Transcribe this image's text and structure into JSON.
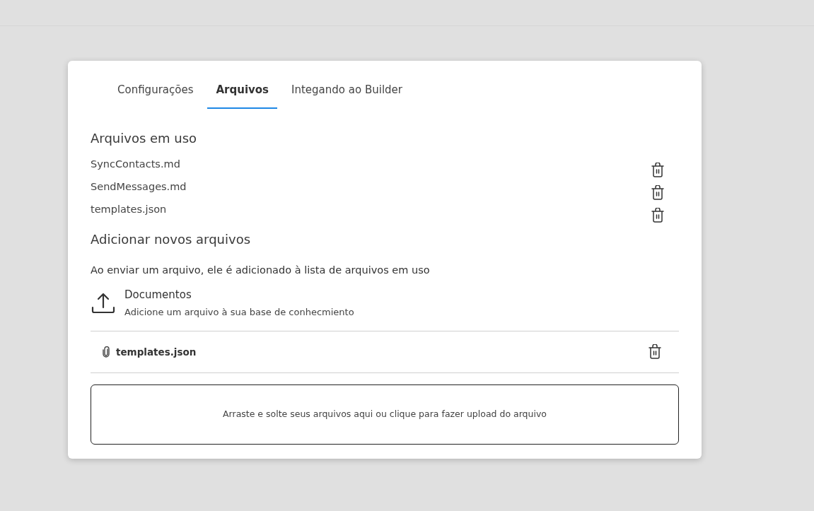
{
  "tabs": [
    {
      "label": "Configurações",
      "selected": false
    },
    {
      "label": "Arquivos",
      "selected": true
    },
    {
      "label": "Integando ao Builder",
      "selected": false
    }
  ],
  "files_in_use": {
    "title": "Arquivos em uso",
    "files": [
      {
        "name": "SyncContacts.md"
      },
      {
        "name": "SendMessages.md"
      },
      {
        "name": "templates.json"
      }
    ]
  },
  "add_files": {
    "title": "Adicionar novos arquivos",
    "description": "Ao enviar um arquivo, ele é adicionado à lista de arquivos em uso",
    "upload": {
      "title": "Documentos",
      "subtitle": "Adicione um arquivo à sua base de conhecmiento"
    },
    "pending_files": [
      {
        "name": "templates.json"
      }
    ],
    "dropzone": "Arraste e solte seus arquivos aqui ou clique para fazer upload do arquivo"
  }
}
